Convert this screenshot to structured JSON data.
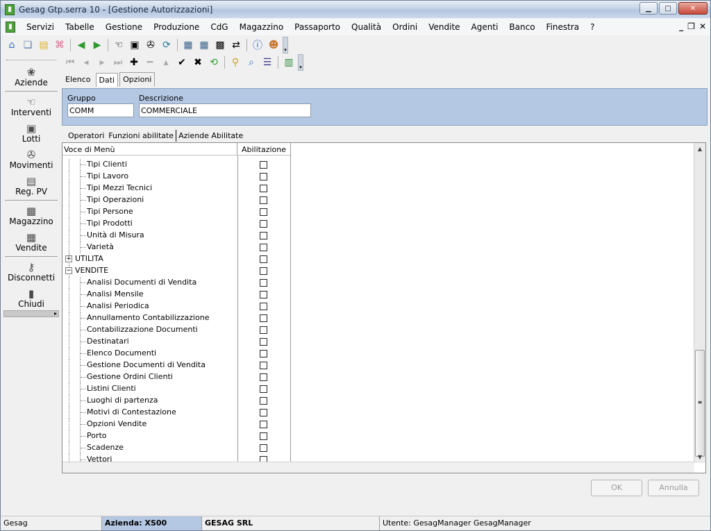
{
  "window": {
    "title": "Gesag Gtp.serra 10 - [Gestione Autorizzazioni]"
  },
  "menubar": {
    "items": [
      "Servizi",
      "Tabelle",
      "Gestione",
      "Produzione",
      "CdG",
      "Magazzino",
      "Passaporto",
      "Qualità",
      "Ordini",
      "Vendite",
      "Agenti",
      "Banco",
      "Finestra",
      "?"
    ]
  },
  "sidebar": {
    "items": [
      {
        "label": "Aziende",
        "icon": "flower-icon"
      },
      {
        "label": "Interventi",
        "icon": "hand-icon"
      },
      {
        "label": "Lotti",
        "icon": "lots-icon"
      },
      {
        "label": "Movimenti",
        "icon": "movements-icon"
      },
      {
        "label": "Reg. PV",
        "icon": "register-icon"
      },
      {
        "label": "Magazzino",
        "icon": "warehouse-icon"
      },
      {
        "label": "Vendite",
        "icon": "sales-icon"
      },
      {
        "label": "Disconnetti",
        "icon": "keys-icon"
      },
      {
        "label": "Chiudi",
        "icon": "door-icon"
      }
    ]
  },
  "tabs": {
    "primary": [
      "Elenco",
      "Dati",
      "Opzioni"
    ],
    "secondary": [
      "Operatori",
      "Funzioni abilitate",
      "Aziende Abilitate"
    ]
  },
  "form": {
    "gruppo_label": "Gruppo",
    "gruppo_value": "COMM",
    "descrizione_label": "Descrizione",
    "descrizione_value": "COMMERCIALE"
  },
  "grid": {
    "col_menu": "Voce di Menù",
    "col_abilitazione": "Abilitazione",
    "rows": [
      {
        "text": "Tipi Clienti",
        "level": 2
      },
      {
        "text": "Tipi Lavoro",
        "level": 2
      },
      {
        "text": "Tipi Mezzi Tecnici",
        "level": 2
      },
      {
        "text": "Tipi Operazioni",
        "level": 2
      },
      {
        "text": "Tipi Persone",
        "level": 2
      },
      {
        "text": "Tipi Prodotti",
        "level": 2
      },
      {
        "text": "Unità di Misura",
        "level": 2
      },
      {
        "text": "Varietà",
        "level": 2
      },
      {
        "text": "UTILITA",
        "level": 1,
        "expander": "+"
      },
      {
        "text": "VENDITE",
        "level": 1,
        "expander": "−"
      },
      {
        "text": "Analisi Documenti di Vendita",
        "level": 2
      },
      {
        "text": "Analisi Mensile",
        "level": 2
      },
      {
        "text": "Analisi Periodica",
        "level": 2
      },
      {
        "text": "Annullamento Contabilizzazione",
        "level": 2
      },
      {
        "text": "Contabilizzazione Documenti",
        "level": 2
      },
      {
        "text": "Destinatari",
        "level": 2
      },
      {
        "text": "Elenco Documenti",
        "level": 2
      },
      {
        "text": "Gestione Documenti di Vendita",
        "level": 2
      },
      {
        "text": "Gestione Ordini Clienti",
        "level": 2
      },
      {
        "text": "Listini Clienti",
        "level": 2
      },
      {
        "text": "Luoghi di partenza",
        "level": 2
      },
      {
        "text": "Motivi di Contestazione",
        "level": 2
      },
      {
        "text": "Opzioni Vendite",
        "level": 2
      },
      {
        "text": "Porto",
        "level": 2
      },
      {
        "text": "Scadenze",
        "level": 2
      },
      {
        "text": "Vettori",
        "level": 2
      }
    ]
  },
  "buttons": {
    "ok": "OK",
    "annulla": "Annulla"
  },
  "statusbar": {
    "app": "Gesag",
    "azienda": "Azienda: XS00",
    "company": "GESAG SRL",
    "utente": "Utente: GesagManager GesagManager"
  }
}
